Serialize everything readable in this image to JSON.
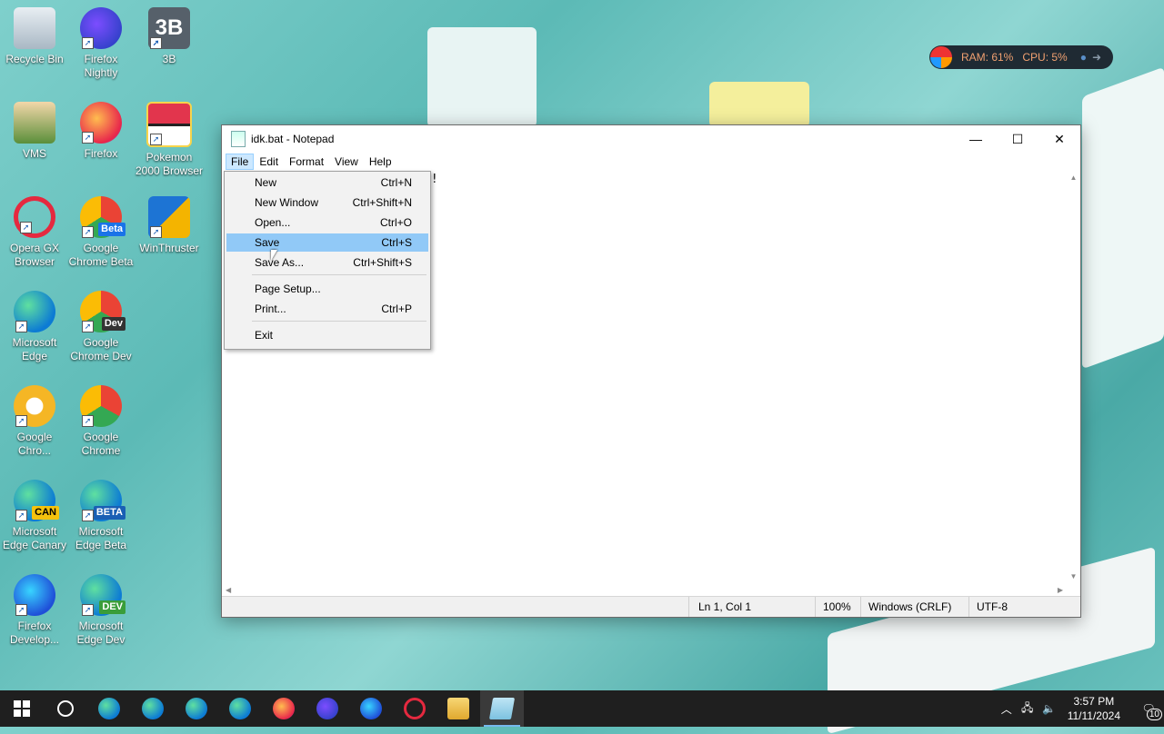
{
  "desktop": {
    "icons": [
      {
        "label": "Recycle Bin",
        "name": "recycle-bin-icon"
      },
      {
        "label": "Firefox Nightly",
        "name": "firefox-nightly-icon"
      },
      {
        "label": "3B",
        "name": "3b-app-icon"
      },
      {
        "label": "VMS",
        "name": "vms-icon"
      },
      {
        "label": "Firefox",
        "name": "firefox-icon"
      },
      {
        "label": "Pokemon 2000 Browser",
        "name": "pokeball-icon"
      },
      {
        "label": "Opera GX Browser",
        "name": "opera-gx-icon"
      },
      {
        "label": "Google Chrome Beta",
        "name": "chrome-beta-icon",
        "badge": "Beta"
      },
      {
        "label": "WinThruster",
        "name": "winthruster-icon"
      },
      {
        "label": "Microsoft Edge",
        "name": "edge-icon"
      },
      {
        "label": "Google Chrome Dev",
        "name": "chrome-dev-icon",
        "badge": "Dev"
      },
      {
        "label": "Google Chro...",
        "name": "chrome-canary-icon"
      },
      {
        "label": "Google Chrome",
        "name": "chrome-icon"
      },
      {
        "label": "Microsoft Edge Canary",
        "name": "edge-canary-icon",
        "badge": "CAN"
      },
      {
        "label": "Microsoft Edge Beta",
        "name": "edge-beta-icon",
        "badge": "BETA"
      },
      {
        "label": "Firefox Develop...",
        "name": "firefox-developer-icon"
      },
      {
        "label": "Microsoft Edge Dev",
        "name": "edge-dev-icon",
        "badge": "DEV"
      }
    ]
  },
  "monitor": {
    "ram": "RAM: 61%",
    "cpu": "CPU: 5%"
  },
  "window": {
    "title": "idk.bat - Notepad",
    "minimize": "—",
    "maximize": "☐",
    "close": "✕",
    "menus": [
      "File",
      "Edit",
      "Format",
      "View",
      "Help"
    ],
    "content_visible": "d!",
    "status": {
      "position": "Ln 1, Col 1",
      "zoom": "100%",
      "line_ending": "Windows (CRLF)",
      "encoding": "UTF-8"
    }
  },
  "file_menu": {
    "items": [
      {
        "label": "New",
        "shortcut": "Ctrl+N"
      },
      {
        "label": "New Window",
        "shortcut": "Ctrl+Shift+N"
      },
      {
        "label": "Open...",
        "shortcut": "Ctrl+O"
      },
      {
        "label": "Save",
        "shortcut": "Ctrl+S",
        "highlighted": true
      },
      {
        "label": "Save As...",
        "shortcut": "Ctrl+Shift+S"
      },
      {
        "label": "Page Setup...",
        "shortcut": ""
      },
      {
        "label": "Print...",
        "shortcut": "Ctrl+P"
      },
      {
        "label": "Exit",
        "shortcut": ""
      }
    ]
  },
  "taskbar": {
    "time": "3:57 PM",
    "date": "11/11/2024",
    "notifications": "10",
    "apps": [
      "start-icon",
      "search-icon",
      "edge-icon",
      "edge-beta-icon",
      "edge-canary-icon",
      "edge-dev-icon",
      "firefox-icon",
      "firefox-nightly-icon",
      "firefox-developer-icon",
      "opera-gx-icon",
      "file-explorer-icon",
      "notepad-icon"
    ]
  }
}
